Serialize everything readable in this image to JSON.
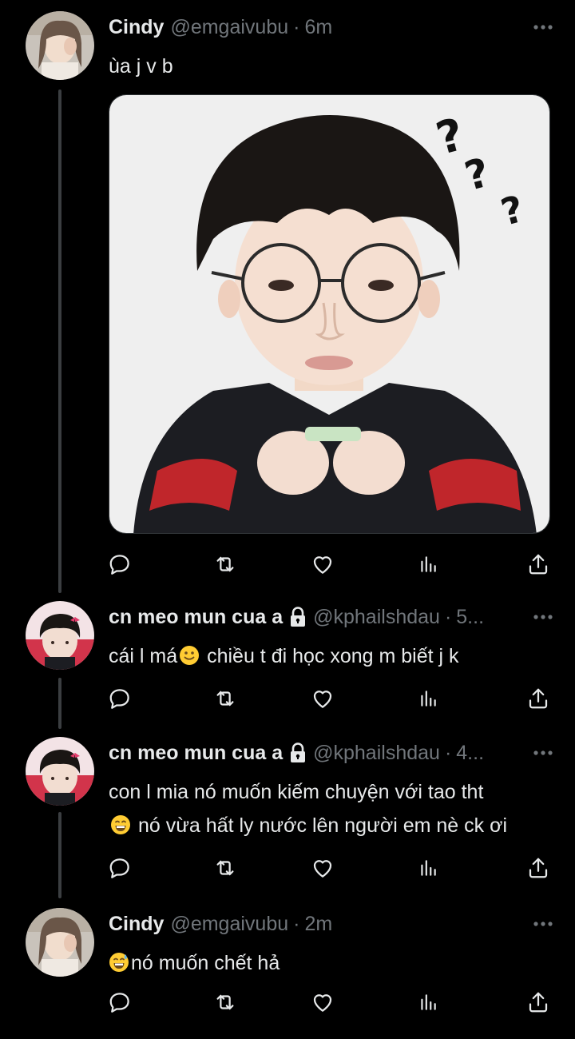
{
  "tweets": [
    {
      "name": "Cindy",
      "handle": "@emgaivubu",
      "time": "6m",
      "text": "ùa j v b"
    },
    {
      "name": "cn meo mun cua a",
      "handle": "@kphailshdau",
      "time": "5...",
      "text": "cái l má",
      "text_after": " chiều t đi học xong m biết j k"
    },
    {
      "name": "cn meo mun cua a",
      "handle": "@kphailshdau",
      "time": "4...",
      "text": "con l mia nó muốn kiếm chuyện với tao tht",
      "text_line2": " nó vừa hất ly nước lên người em nè ck ơi"
    },
    {
      "name": "Cindy",
      "handle": "@emgaivubu",
      "time": "2m",
      "text": "nó muốn chết hả"
    }
  ],
  "icons": {
    "reply": "reply-icon",
    "retweet": "retweet-icon",
    "like": "heart-icon",
    "views": "views-icon",
    "share": "share-icon",
    "more": "more-icon",
    "lock": "lock-icon"
  },
  "colors": {
    "background": "#000000",
    "text": "#e7e9ea",
    "secondary": "#71767b",
    "thread_line": "#3b3e41"
  }
}
